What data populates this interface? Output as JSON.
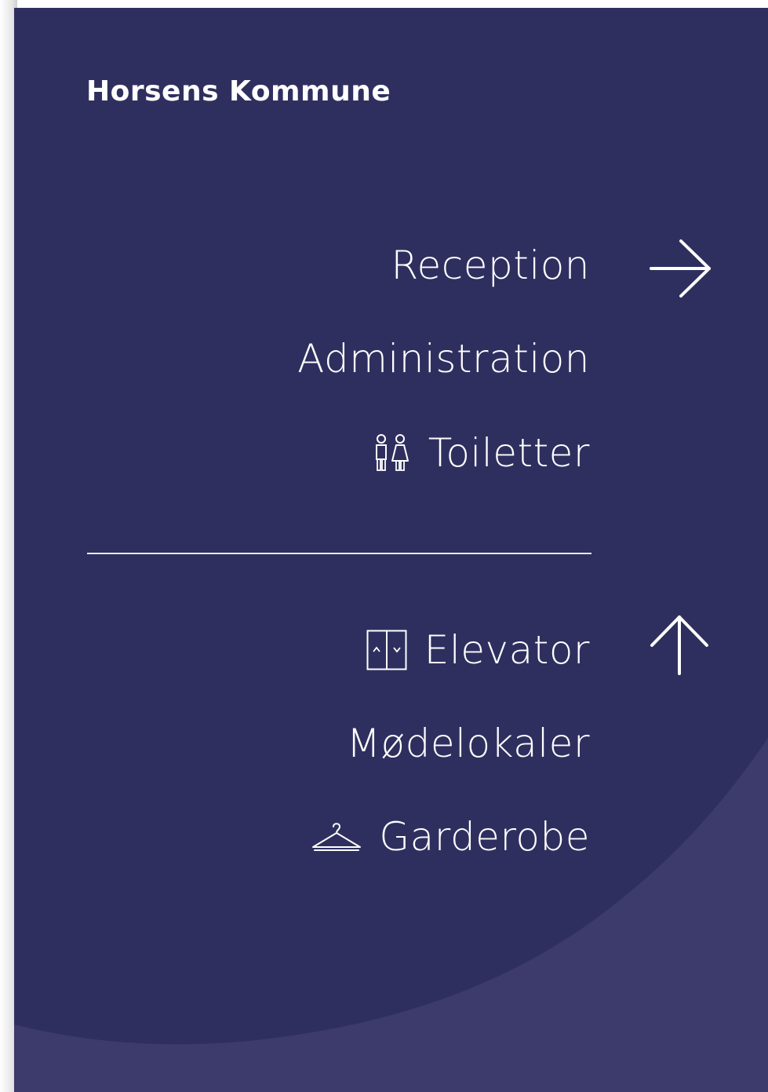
{
  "sign": {
    "logo_text": "Horsens Kommune",
    "group_1": {
      "direction": "right-arrow-icon",
      "items": [
        {
          "label": "Reception",
          "icon": null
        },
        {
          "label": "Administration",
          "icon": null
        },
        {
          "label": "Toiletter",
          "icon": "toilet-icon"
        }
      ]
    },
    "group_2": {
      "direction": "up-arrow-icon",
      "items": [
        {
          "label": "Elevator",
          "icon": "elevator-icon"
        },
        {
          "label": "Mødelokaler",
          "icon": null
        },
        {
          "label": "Garderobe",
          "icon": "hanger-icon"
        }
      ]
    },
    "colors": {
      "background": "#2f2f5f",
      "curve": "#3d3b6c",
      "text": "#ffffff"
    }
  }
}
